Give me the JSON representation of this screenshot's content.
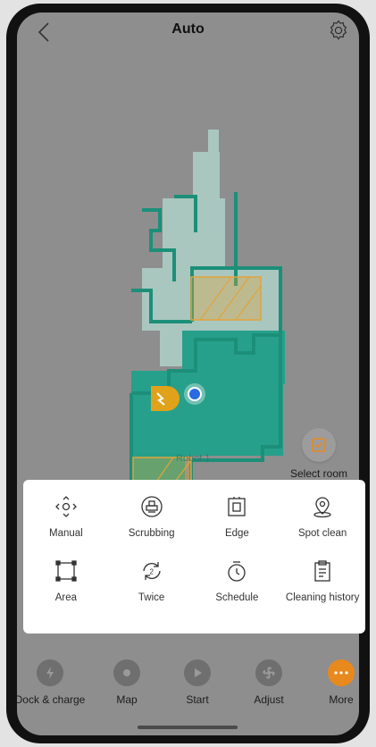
{
  "header": {
    "title": "Auto",
    "back_icon": "chevron-left-icon",
    "settings_icon": "gear-icon"
  },
  "map": {
    "robot_label": "Robot 1",
    "select_room_label": "Select room",
    "colors": {
      "cleaned": "#26a08a",
      "uncleaned": "#a9c7bf",
      "no_go": "#e2a33a",
      "dock": "#e0a21a",
      "robot": "#2a6be0"
    }
  },
  "tools": [
    {
      "label": "Manual",
      "icon": "move-arrows-icon"
    },
    {
      "label": "Scrubbing",
      "icon": "mop-icon"
    },
    {
      "label": "Edge",
      "icon": "edge-icon"
    },
    {
      "label": "Spot clean",
      "icon": "location-pin-icon"
    },
    {
      "label": "Area",
      "icon": "area-square-icon"
    },
    {
      "label": "Twice",
      "icon": "repeat-twice-icon"
    },
    {
      "label": "Schedule",
      "icon": "timer-icon"
    },
    {
      "label": "Cleaning history",
      "icon": "history-document-icon"
    }
  ],
  "bottom_nav": [
    {
      "label": "Dock & charge",
      "icon": "dock-charge-icon"
    },
    {
      "label": "Map",
      "icon": "map-pin-icon"
    },
    {
      "label": "Start",
      "icon": "play-icon"
    },
    {
      "label": "Adjust",
      "icon": "fan-icon"
    },
    {
      "label": "More",
      "icon": "more-dots-icon",
      "active": true,
      "active_color": "#e8891d"
    }
  ]
}
